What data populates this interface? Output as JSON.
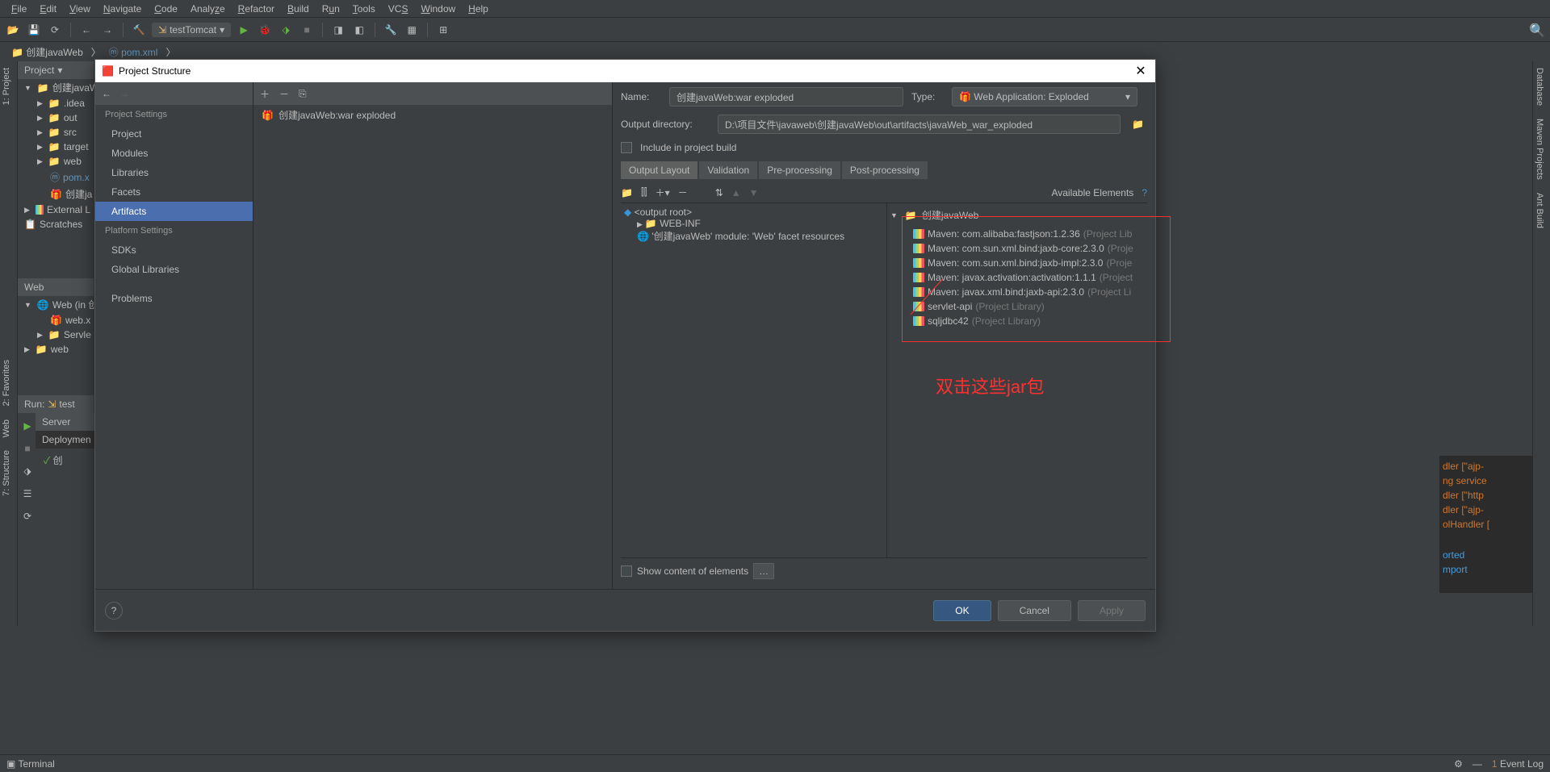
{
  "menu": {
    "items": [
      "File",
      "Edit",
      "View",
      "Navigate",
      "Code",
      "Analyze",
      "Refactor",
      "Build",
      "Run",
      "Tools",
      "VCS",
      "Window",
      "Help"
    ]
  },
  "toolbar": {
    "run_config": "testTomcat"
  },
  "breadcrumb": {
    "project": "创建javaWeb",
    "file": "pom.xml"
  },
  "project_panel": {
    "title": "Project",
    "root": "创建javaW",
    "items": [
      ".idea",
      "out",
      "src",
      "target",
      "web",
      "pom.x",
      "创建ja"
    ],
    "external": "External L",
    "scratches": "Scratches"
  },
  "web_panel": {
    "title": "Web",
    "root": "Web (in 创",
    "items": [
      "web.x",
      "Servle",
      "web"
    ]
  },
  "run_panel": {
    "title": "Run:",
    "config": "test",
    "tab1": "Server",
    "tab2": "Deploymen",
    "artifact": "创"
  },
  "dialog": {
    "title": "Project Structure",
    "sidebar": {
      "section1": "Project Settings",
      "items1": [
        "Project",
        "Modules",
        "Libraries",
        "Facets",
        "Artifacts"
      ],
      "section2": "Platform Settings",
      "items2": [
        "SDKs",
        "Global Libraries"
      ],
      "section3": "Problems"
    },
    "artifact_list": [
      "创建javaWeb:war exploded"
    ],
    "form": {
      "name_label": "Name:",
      "name_value": "创建javaWeb:war exploded",
      "type_label": "Type:",
      "type_value": "Web Application: Exploded",
      "output_label": "Output directory:",
      "output_value": "D:\\项目文件\\javaweb\\创建javaWeb\\out\\artifacts\\javaWeb_war_exploded",
      "include_label": "Include in project build"
    },
    "tabs": [
      "Output Layout",
      "Validation",
      "Pre-processing",
      "Post-processing"
    ],
    "available_elements": "Available Elements",
    "output_root": "<output root>",
    "webinf": "WEB-INF",
    "facet_resource": "'创建javaWeb' module: 'Web' facet resources",
    "ae_root": "创建javaWeb",
    "ae_items": [
      {
        "name": "Maven: com.alibaba:fastjson:1.2.36",
        "hint": "(Project Lib"
      },
      {
        "name": "Maven: com.sun.xml.bind:jaxb-core:2.3.0",
        "hint": "(Proje"
      },
      {
        "name": "Maven: com.sun.xml.bind:jaxb-impl:2.3.0",
        "hint": "(Proje"
      },
      {
        "name": "Maven: javax.activation:activation:1.1.1",
        "hint": "(Project"
      },
      {
        "name": "Maven: javax.xml.bind:jaxb-api:2.3.0",
        "hint": "(Project Li"
      },
      {
        "name": "servlet-api",
        "hint": "(Project Library)"
      },
      {
        "name": "sqljdbc42",
        "hint": "(Project Library)"
      }
    ],
    "annotation": "双击这些jar包",
    "show_content": "Show content of elements",
    "buttons": {
      "ok": "OK",
      "cancel": "Cancel",
      "apply": "Apply"
    }
  },
  "right_tabs": [
    "Database",
    "Maven Projects",
    "Ant Build"
  ],
  "left_tabs": [
    "1: Project",
    "2: Favorites",
    "Web",
    "7: Structure"
  ],
  "console": {
    "lines": [
      "dler [\"ajp-",
      "ng service",
      "dler [\"http",
      "dler [\"ajp-",
      "olHandler ["
    ],
    "footer1": "orted",
    "footer2": "mport"
  },
  "statusbar": {
    "terminal": "Terminal",
    "eventlog": "Event Log"
  }
}
